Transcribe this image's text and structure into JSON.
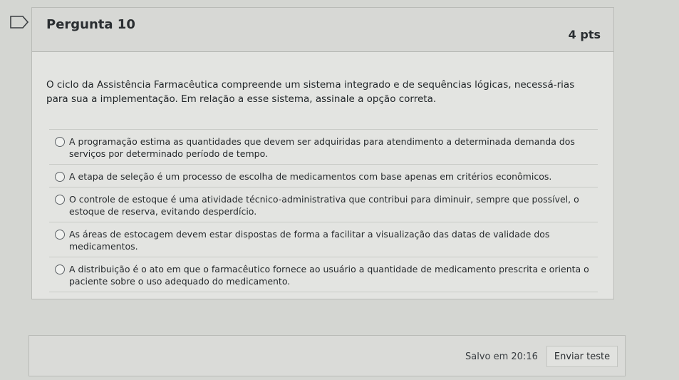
{
  "question": {
    "title": "Pergunta 10",
    "points": "4 pts",
    "text": "O ciclo da Assistência Farmacêutica compreende um sistema integrado e de sequências lógicas, necessá-rias para sua a implementação. Em relação a esse sistema, assinale a opção correta.",
    "options": [
      {
        "label": "A programação estima as quantidades que devem ser adquiridas para atendimento a determinada demanda dos serviços por determinado período de tempo."
      },
      {
        "label": "A etapa de seleção é um processo de escolha de medicamentos com base apenas em critérios econômicos."
      },
      {
        "label": "O controle de estoque é uma atividade técnico-administrativa que contribui para diminuir, sempre que possível, o estoque de reserva, evitando desperdício."
      },
      {
        "label": "As áreas de estocagem devem estar dispostas de forma a facilitar a visualização das datas de validade dos medicamentos."
      },
      {
        "label": "A distribuição é o ato em que o farmacêutico fornece ao usuário a quantidade de medicamento prescrita e orienta o paciente sobre o uso adequado do medicamento."
      }
    ]
  },
  "footer": {
    "saved_text": "Salvo em 20:16",
    "submit_label": "Enviar teste"
  },
  "colors": {
    "background": "#d4d6d2",
    "card": "#e3e4e1",
    "header": "#d7d8d5",
    "text": "#1f2427"
  },
  "icons": {
    "flag": "flag-icon",
    "radio": "radio-unselected"
  }
}
